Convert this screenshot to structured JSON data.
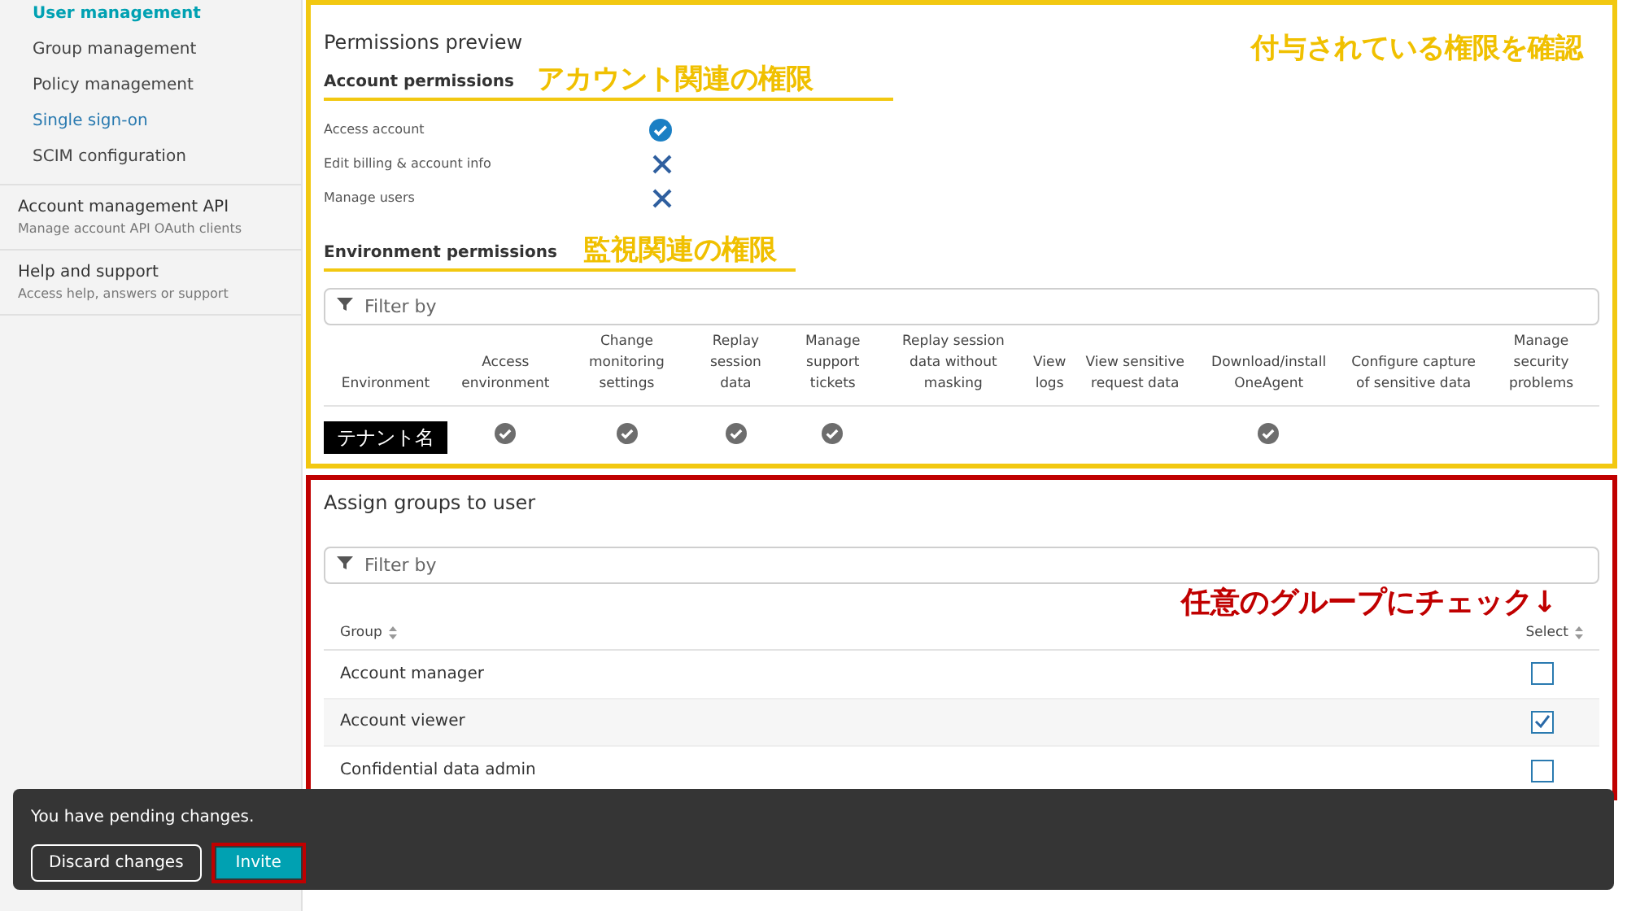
{
  "sidebar": {
    "items": [
      {
        "label": "User management",
        "selected": true
      },
      {
        "label": "Group management",
        "selected": false
      },
      {
        "label": "Policy management",
        "selected": false
      },
      {
        "label": "Single sign-on",
        "selected": false,
        "kind": "link"
      },
      {
        "label": "SCIM configuration",
        "selected": false
      }
    ],
    "sections": [
      {
        "title": "Account management API",
        "subtitle": "Manage account API OAuth clients"
      },
      {
        "title": "Help and support",
        "subtitle": "Access help, answers or support"
      }
    ]
  },
  "permissions_preview": {
    "title": "Permissions preview",
    "annotation": "付与されている権限を確認",
    "account": {
      "heading": "Account permissions",
      "annotation": "アカウント関連の権限",
      "items": [
        {
          "label": "Access account",
          "granted": true
        },
        {
          "label": "Edit billing & account info",
          "granted": false
        },
        {
          "label": "Manage users",
          "granted": false
        }
      ]
    },
    "environment": {
      "heading": "Environment permissions",
      "annotation": "監視関連の権限",
      "filter_placeholder": "Filter by",
      "columns": [
        "Environment",
        "Access environment",
        "Change monitoring settings",
        "Replay session data",
        "Manage support tickets",
        "Replay session data without masking",
        "View logs",
        "View sensitive request data",
        "Download/install OneAgent",
        "Configure capture of sensitive data",
        "Manage security problems"
      ],
      "rows": [
        {
          "environment": "テナント名",
          "granted": [
            true,
            true,
            true,
            true,
            false,
            false,
            false,
            true,
            false,
            false
          ]
        }
      ]
    }
  },
  "assign_groups": {
    "title": "Assign groups to user",
    "filter_placeholder": "Filter by",
    "annotation": "任意のグループにチェック↓",
    "columns": [
      "Group",
      "Select"
    ],
    "rows": [
      {
        "group": "Account manager",
        "checked": false
      },
      {
        "group": "Account viewer",
        "checked": true
      },
      {
        "group": "Confidential data admin",
        "checked": false
      }
    ]
  },
  "pending_bar": {
    "message": "You have pending changes.",
    "buttons": [
      {
        "label": "Discard changes",
        "kind": "secondary"
      },
      {
        "label": "Invite",
        "kind": "primary"
      }
    ]
  }
}
